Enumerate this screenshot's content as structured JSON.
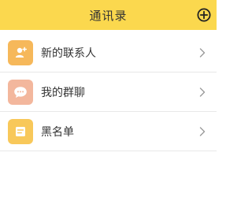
{
  "header": {
    "title": "通讯录",
    "add_icon": "plus-circle-icon"
  },
  "colors": {
    "header_bg": "#FBD84E",
    "new_contacts_icon_bg": "#F6B85A",
    "group_chat_icon_bg": "#F3B79D",
    "blacklist_icon_bg": "#F8C85A"
  },
  "items": [
    {
      "label": "新的联系人",
      "icon": "new-contact-icon",
      "chevron": "chevron-right-icon"
    },
    {
      "label": "我的群聊",
      "icon": "group-chat-icon",
      "chevron": "chevron-right-icon"
    },
    {
      "label": "黑名单",
      "icon": "blacklist-icon",
      "chevron": "chevron-right-icon"
    }
  ]
}
